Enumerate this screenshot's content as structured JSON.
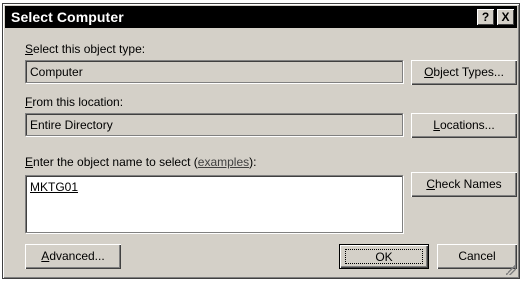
{
  "window": {
    "title": "Select Computer",
    "help_label": "?",
    "close_label": "X"
  },
  "object_type": {
    "label_mnemonic": "S",
    "label_rest": "elect this object type:",
    "value": "Computer",
    "button_mnemonic": "O",
    "button_rest": "bject Types..."
  },
  "location": {
    "label_mnemonic": "F",
    "label_rest": "rom this location:",
    "value": "Entire Directory",
    "button_mnemonic": "L",
    "button_rest": "ocations..."
  },
  "object_name": {
    "label_mnemonic": "E",
    "label_pre": "nter the object name to select (",
    "examples_link": "examples",
    "label_post": "):",
    "value": "MKTG01",
    "check_mnemonic": "C",
    "check_rest": "heck Names"
  },
  "footer": {
    "advanced_mnemonic": "A",
    "advanced_rest": "dvanced...",
    "ok_label": "OK",
    "cancel_label": "Cancel"
  }
}
